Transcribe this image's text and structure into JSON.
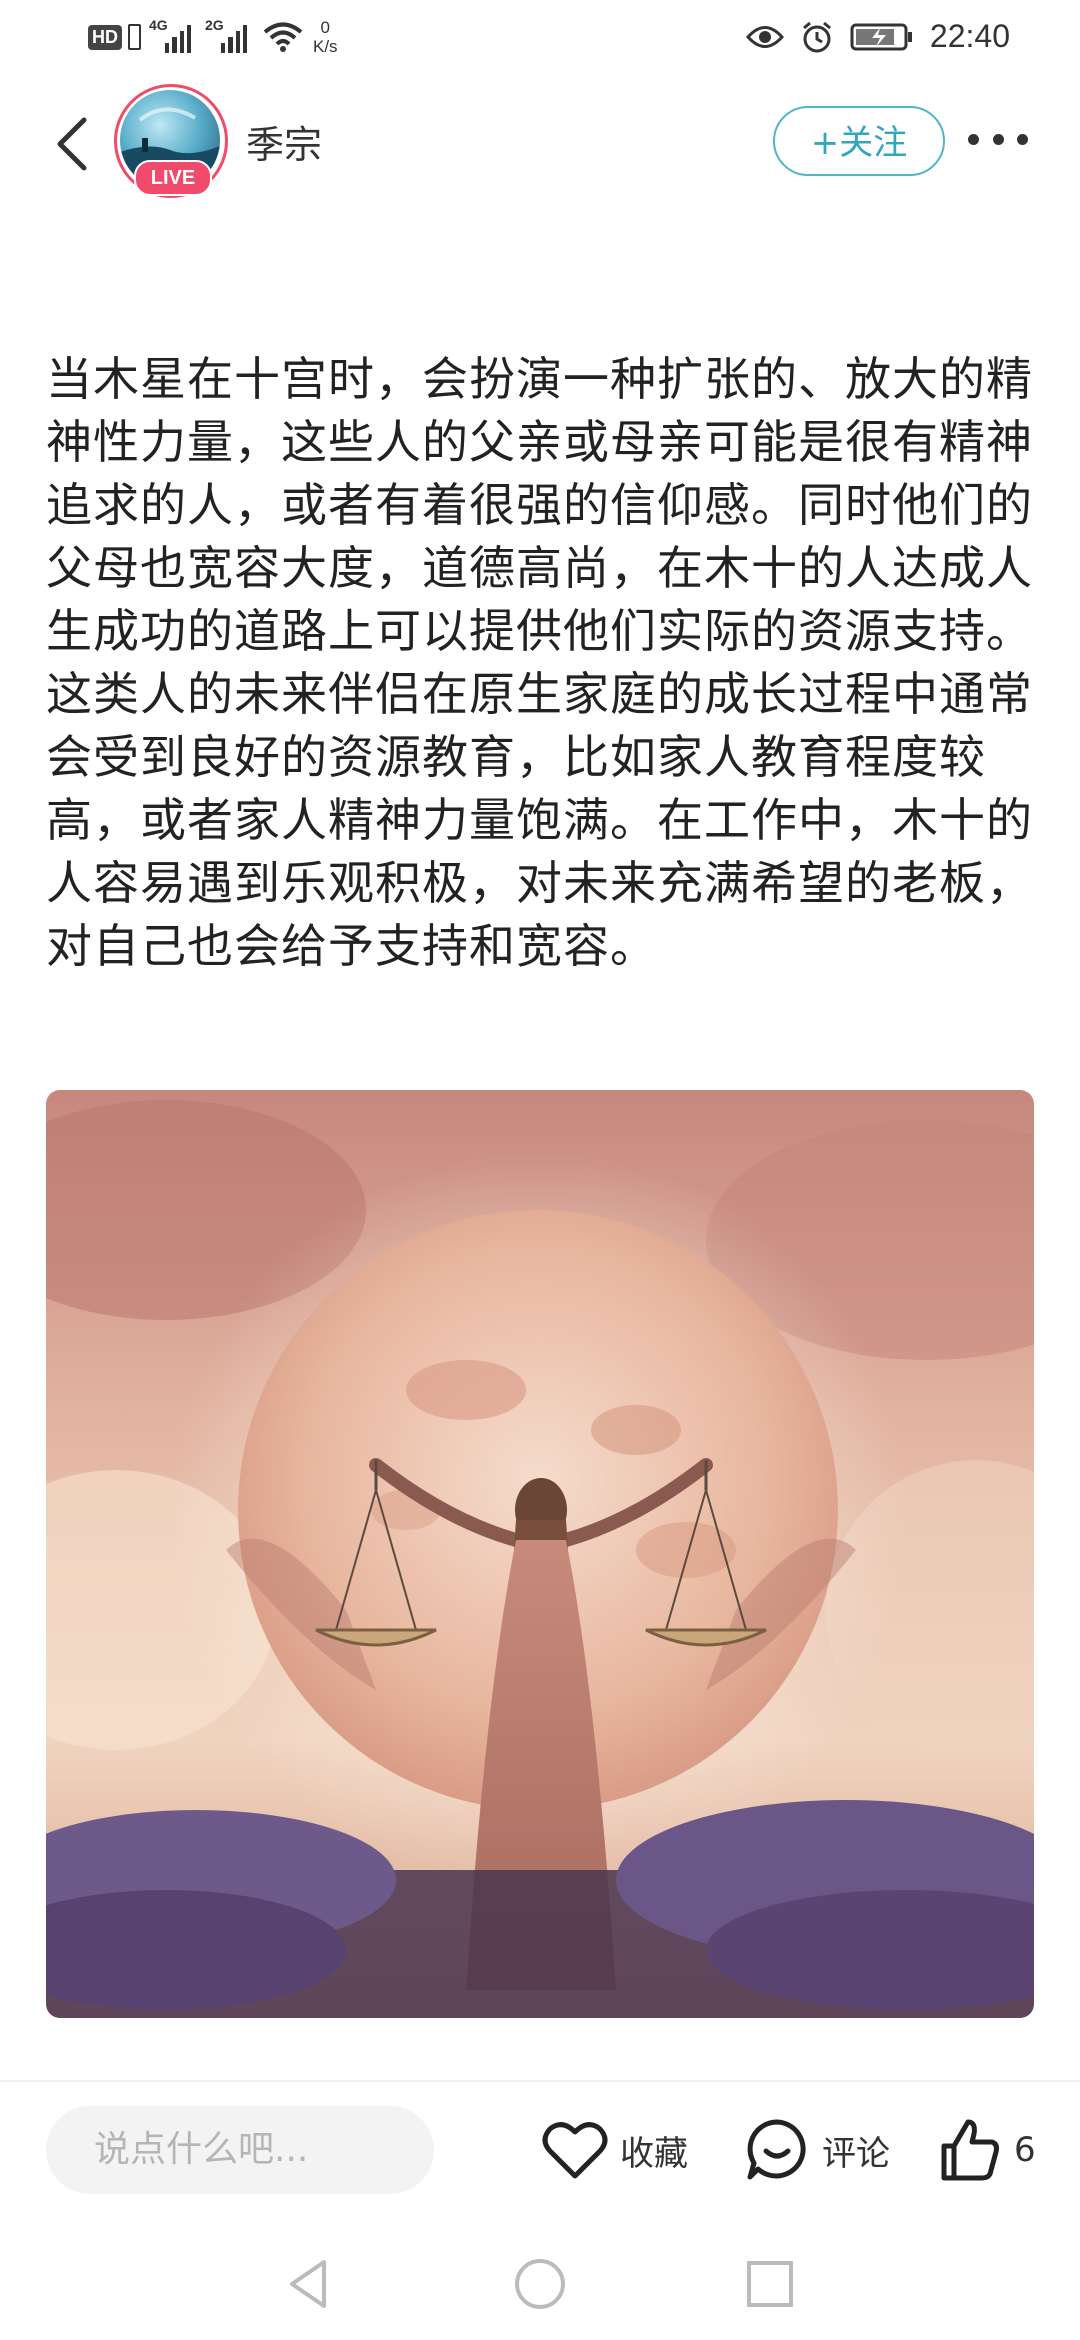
{
  "status_bar": {
    "hd_label": "HD",
    "sim1_label": "4G",
    "sim2_label": "2G",
    "net_speed_value": "0",
    "net_speed_unit": "K/s",
    "time": "22:40"
  },
  "header": {
    "username": "季宗",
    "live_label": "LIVE",
    "follow_label": "+关注"
  },
  "post": {
    "body": "当木星在十宫时，会扮演一种扩张的、放大的精神性力量，这些人的父亲或母亲可能是很有精神追求的人，或者有着很强的信仰感。同时他们的父母也宽容大度，道德高尚，在木十的人达成人生成功的道路上可以提供他们实际的资源支持。这类人的未来伴侣在原生家庭的成长过程中通常会受到良好的资源教育，比如家人教育程度较高，或者家人精神力量饱满。在工作中，木十的人容易遇到乐观积极，对未来充满希望的老板，对自己也会给予支持和宽容。"
  },
  "bottom_bar": {
    "comment_placeholder": "说点什么吧...",
    "favorite_label": "收藏",
    "comment_label": "评论",
    "like_count": "6"
  },
  "colors": {
    "accent": "#2fa7bd",
    "live_badge": "#f04b6a"
  }
}
